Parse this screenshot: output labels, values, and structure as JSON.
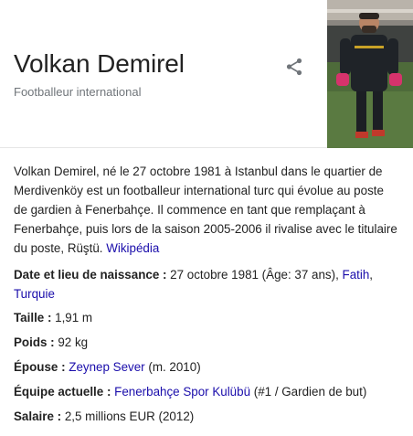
{
  "header": {
    "title": "Volkan Demirel",
    "subtitle": "Footballeur international"
  },
  "description": {
    "text": "Volkan Demirel, né le 27 octobre 1981 à Istanbul dans le quartier de Merdivenköy est un footballeur international turc qui évolue au poste de gardien à Fenerbahçe. Il commence en tant que remplaçant à Fenerbahçe, puis lors de la saison 2005-2006 il rivalise avec le titulaire du poste, Rüştü. ",
    "source_link": "Wikipédia"
  },
  "facts": {
    "birth": {
      "label": "Date et lieu de naissance : ",
      "value": "27 octobre 1981 (Âge: 37 ans), ",
      "link1": "Fatih",
      "sep": ", ",
      "link2": "Turquie"
    },
    "height": {
      "label": "Taille : ",
      "value": "1,91 m"
    },
    "weight": {
      "label": "Poids : ",
      "value": "92 kg"
    },
    "spouse": {
      "label": "Épouse : ",
      "link": "Zeynep Sever",
      "value": " (m. 2010)"
    },
    "team": {
      "label": "Équipe actuelle : ",
      "link": "Fenerbahçe Spor Kulübü",
      "value": " (#1 / Gardien de but)"
    },
    "salary": {
      "label": "Salaire : ",
      "value": "2,5 millions EUR (2012)"
    }
  },
  "colors": {
    "link": "#1a0dab",
    "text": "#222222",
    "subtitle": "#70757a"
  },
  "icons": {
    "share": "share-icon"
  }
}
